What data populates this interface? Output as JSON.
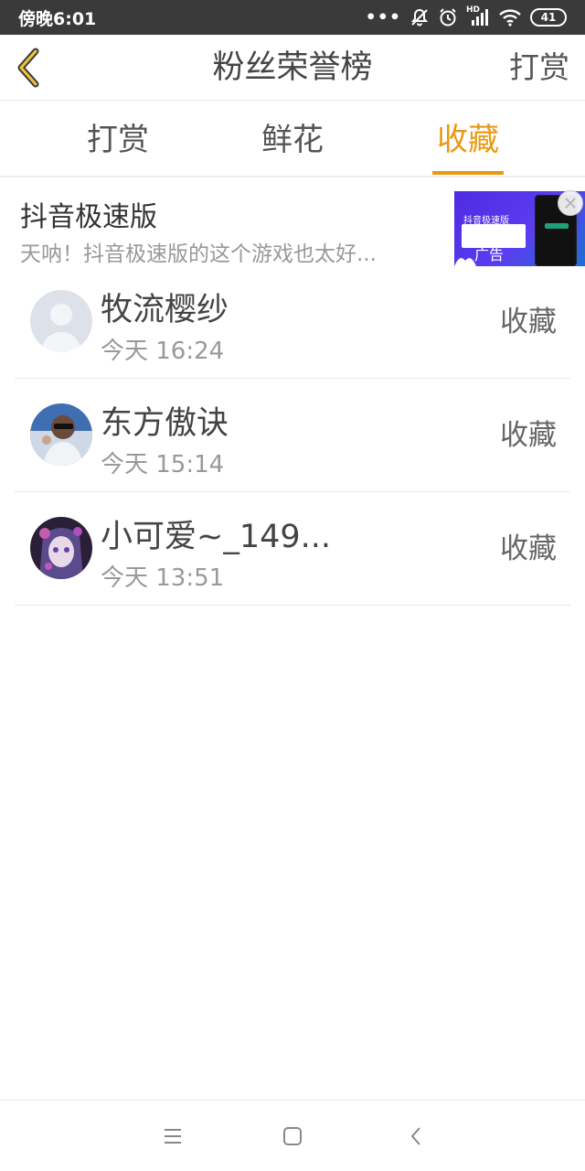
{
  "status_bar": {
    "time": "傍晚6:01",
    "signal_label": "HD",
    "battery": "41",
    "icons": [
      "more-dots-icon",
      "bell-off-icon",
      "alarm-icon",
      "cell-signal-icon",
      "wifi-icon",
      "battery-icon"
    ]
  },
  "header": {
    "title": "粉丝荣誉榜",
    "right_action": "打赏",
    "back_icon": "chevron-left-icon"
  },
  "tabs": [
    {
      "label": "打赏",
      "active": false
    },
    {
      "label": "鲜花",
      "active": false
    },
    {
      "label": "收藏",
      "active": true
    }
  ],
  "ad": {
    "title": "抖音极速版",
    "description": "天呐！抖音极速版的这个游戏也太好...",
    "card_title": "抖音极速版",
    "badge": "广告"
  },
  "list": [
    {
      "name": "牧流樱纱",
      "time": "今天 16:24",
      "action": "收藏"
    },
    {
      "name": "东方傲诀",
      "time": "今天 15:14",
      "action": "收藏"
    },
    {
      "name": "小可爱~_149...",
      "time": "今天 13:51",
      "action": "收藏"
    }
  ],
  "nav_bar": {
    "icons": [
      "menu-icon",
      "home-square-icon",
      "back-triangle-icon"
    ]
  },
  "colors": {
    "accent": "#e89a12",
    "status_bar_bg": "#3a3a3a",
    "divider": "#e8e8e8"
  }
}
